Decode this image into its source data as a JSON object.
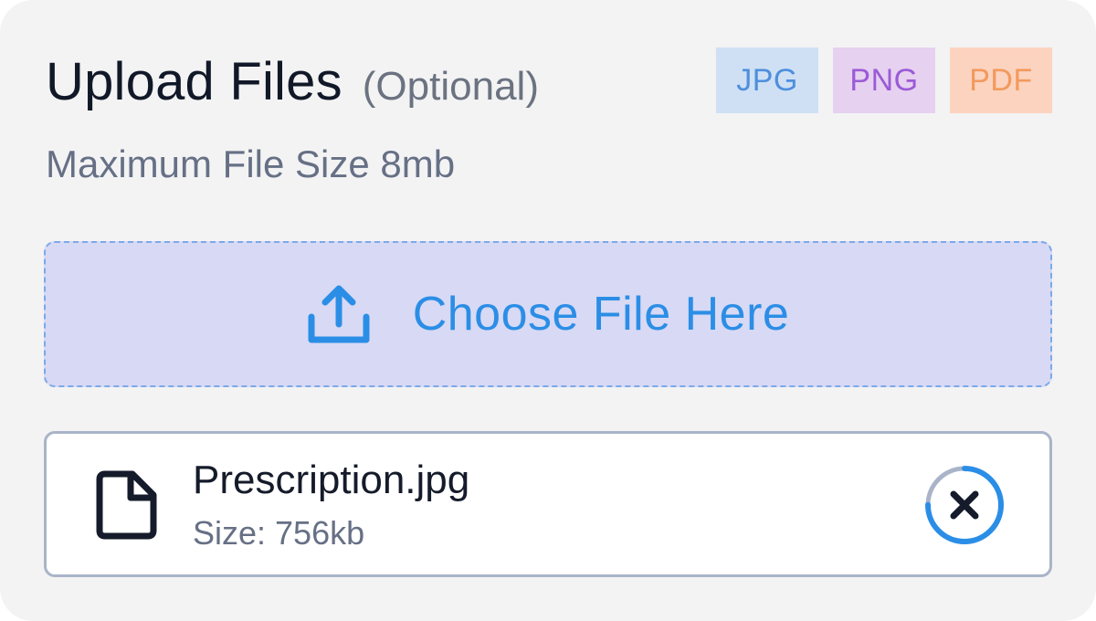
{
  "header": {
    "title": "Upload Files",
    "optional_label": "(Optional)",
    "subtitle": "Maximum File Size 8mb"
  },
  "file_types": [
    {
      "label": "JPG",
      "color": "#4f8fdc"
    },
    {
      "label": "PNG",
      "color": "#9b5bd6"
    },
    {
      "label": "PDF",
      "color": "#f29a5e"
    }
  ],
  "dropzone": {
    "label": "Choose File Here",
    "icon": "upload-icon"
  },
  "files": [
    {
      "name": "Prescription.jpg",
      "size_text": "Size: 756kb",
      "icon": "file-icon",
      "upload_progress": 0.75
    }
  ],
  "colors": {
    "accent": "#2b8ee6",
    "background": "#f3f3f4"
  }
}
